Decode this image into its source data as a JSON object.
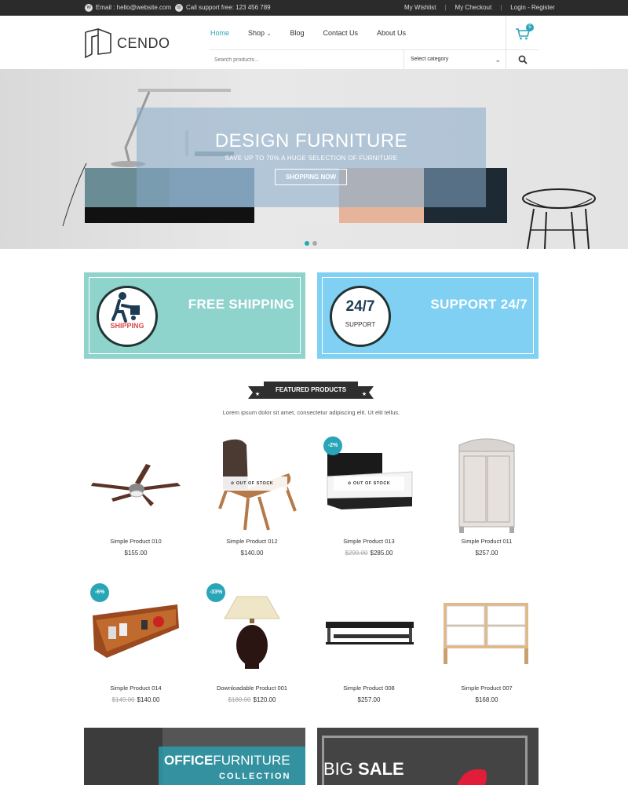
{
  "topbar": {
    "email": "Email : hello@website.com",
    "phone": "Call support free: 123 456 789",
    "wishlist": "My Wishlist",
    "checkout": "My Checkout",
    "account": "Login - Register"
  },
  "brand": {
    "name": "CENDO"
  },
  "nav": [
    "Home",
    "Shop",
    "Blog",
    "Contact Us",
    "About Us"
  ],
  "cart": {
    "count": "5"
  },
  "search": {
    "placeholder": "Search products...",
    "category": "Select category"
  },
  "hero": {
    "title": "DESIGN FURNITURE",
    "subtitle": "SAVE UP TO 70% A HUGE SELECTION OF FURNITURE",
    "button": "SHOPPING NOW"
  },
  "services": {
    "shipping": {
      "title": "FREE SHIPPING",
      "icon_text": "SHIPPING"
    },
    "support": {
      "title": "SUPPORT 24/7",
      "icon_big": "24/7",
      "icon_text": "SUPPORT"
    }
  },
  "featured": {
    "title": "FEATURED PRODUCTS",
    "description": "Lorem ipsum dolor sit amet, consectetur adipiscing elit. Ut elit tellus."
  },
  "products": [
    {
      "name": "Simple Product 010",
      "price": "$155.00",
      "old_price": "",
      "badge": "",
      "stock": ""
    },
    {
      "name": "Simple Product 012",
      "price": "$140.00",
      "old_price": "",
      "badge": "",
      "stock": "OUT OF STOCK"
    },
    {
      "name": "Simple Product 013",
      "price": "$285.00",
      "old_price": "$290.00",
      "badge": "-2%",
      "stock": "OUT OF STOCK"
    },
    {
      "name": "Simple Product 011",
      "price": "$257.00",
      "old_price": "",
      "badge": "",
      "stock": ""
    },
    {
      "name": "Simple Product 014",
      "price": "$140.00",
      "old_price": "$149.00",
      "badge": "-6%",
      "stock": ""
    },
    {
      "name": "Downloadable Product 001",
      "price": "$120.00",
      "old_price": "$180.00",
      "badge": "-33%",
      "stock": ""
    },
    {
      "name": "Simple Product 008",
      "price": "$257.00",
      "old_price": "",
      "badge": "",
      "stock": ""
    },
    {
      "name": "Simple Product 007",
      "price": "$168.00",
      "old_price": "",
      "badge": "",
      "stock": ""
    }
  ],
  "banners": {
    "office_a": "OFFICE",
    "office_b": "FURNITURE",
    "office_c": "COLLECTION",
    "sale_a": "BIG",
    "sale_b": "SALE"
  },
  "colors": {
    "accent": "#2aa5b8",
    "shipping_bg": "#8fd3cd",
    "support_bg": "#7fd0f2",
    "topbar": "#2b2b2b"
  }
}
